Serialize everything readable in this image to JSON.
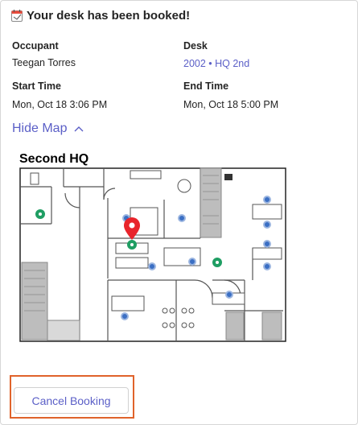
{
  "header": {
    "title": "Your desk has been booked!",
    "icon": "calendar-icon"
  },
  "occupant": {
    "label": "Occupant",
    "value": "Teegan Torres"
  },
  "desk": {
    "label": "Desk",
    "value": "2002 • HQ 2nd"
  },
  "start": {
    "label": "Start Time",
    "value": "Mon, Oct 18 3:06 PM"
  },
  "end": {
    "label": "End Time",
    "value": "Mon, Oct 18 5:00 PM"
  },
  "map": {
    "toggle_label": "Hide Map",
    "title": "Second HQ"
  },
  "actions": {
    "cancel_label": "Cancel Booking"
  },
  "colors": {
    "accent": "#5b5fc7",
    "highlight": "#e0632b",
    "pin": "#e8242b",
    "available": "#1f9e63",
    "desk_dot": "#3b6fc4"
  }
}
